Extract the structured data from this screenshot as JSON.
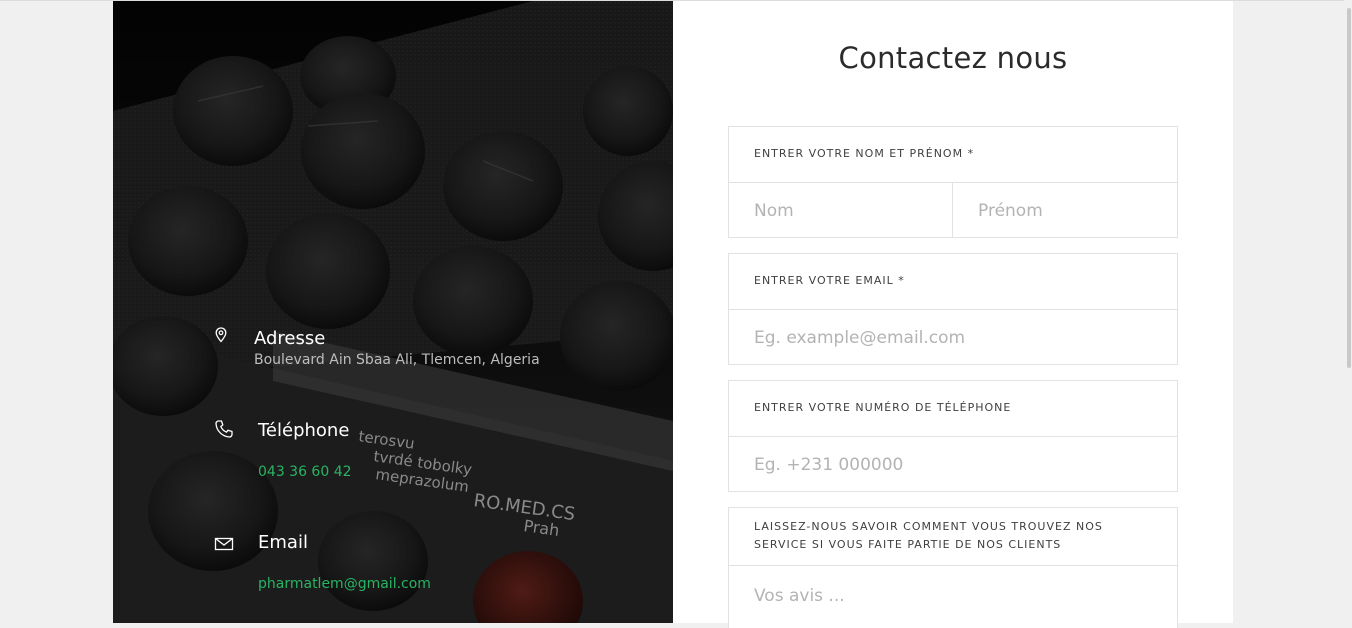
{
  "contact_info": {
    "address": {
      "title": "Adresse",
      "value": "Boulevard Ain Sbaa Ali, Tlemcen, Algeria"
    },
    "phone": {
      "title": "Téléphone",
      "value": "043 36 60 42"
    },
    "email": {
      "title": "Email",
      "value": "pharmatlem@gmail.com"
    },
    "photo_text": {
      "line1": "terosvu",
      "line2": "tvrdé tobolky",
      "line3": "meprazolum",
      "line4": "RO.MED.CS",
      "line5": "Prah"
    }
  },
  "form": {
    "title": "Contactez nous",
    "name_label": "Entrer votre nom et prénom *",
    "last_name_placeholder": "Nom",
    "first_name_placeholder": "Prénom",
    "email_label": "Entrer votre email *",
    "email_placeholder": "Eg. example@email.com",
    "phone_label": "Entrer votre numéro de téléphone",
    "phone_placeholder": "Eg. +231 000000",
    "feedback_label_line1": "Laissez-nous savoir comment vous trouvez nos",
    "feedback_label_line2": "service si vous faite partie de nos clients",
    "feedback_placeholder": "Vos avis ..."
  },
  "colors": {
    "accent_green": "#28b463",
    "panel_dark": "#1c1c1c"
  },
  "icons": {
    "address": "map-pin-icon",
    "phone": "phone-icon",
    "email": "envelope-icon"
  }
}
